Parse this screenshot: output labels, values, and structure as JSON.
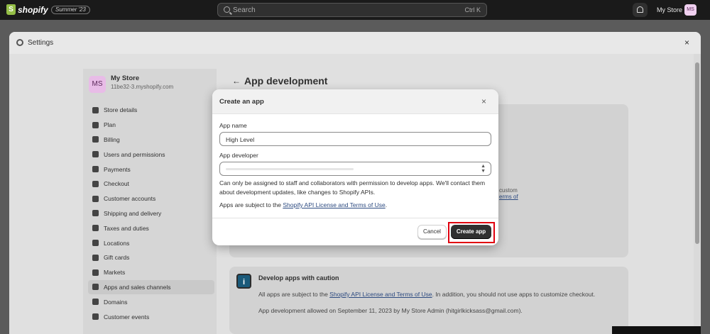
{
  "topbar": {
    "logo_text": "shopify",
    "edition": "Summer '23",
    "search_placeholder": "Search",
    "search_shortcut": "Ctrl K",
    "store_name": "My Store",
    "store_initials": "MS"
  },
  "settings": {
    "title": "Settings",
    "close_glyph": "×",
    "store": {
      "initials": "MS",
      "name": "My Store",
      "domain": "11be32-3.myshopify.com"
    },
    "nav_items": [
      {
        "label": "Store details",
        "icon": "store-icon"
      },
      {
        "label": "Plan",
        "icon": "plan-icon"
      },
      {
        "label": "Billing",
        "icon": "billing-icon"
      },
      {
        "label": "Users and permissions",
        "icon": "users-icon"
      },
      {
        "label": "Payments",
        "icon": "payments-icon"
      },
      {
        "label": "Checkout",
        "icon": "cart-icon"
      },
      {
        "label": "Customer accounts",
        "icon": "customer-icon"
      },
      {
        "label": "Shipping and delivery",
        "icon": "truck-icon"
      },
      {
        "label": "Taxes and duties",
        "icon": "taxes-icon"
      },
      {
        "label": "Locations",
        "icon": "location-icon"
      },
      {
        "label": "Gift cards",
        "icon": "gift-card-icon"
      },
      {
        "label": "Markets",
        "icon": "globe-icon"
      },
      {
        "label": "Apps and sales channels",
        "icon": "apps-icon"
      },
      {
        "label": "Domains",
        "icon": "domain-icon"
      },
      {
        "label": "Customer events",
        "icon": "events-icon"
      }
    ],
    "active_nav": "Apps and sales channels",
    "page_title": "App development",
    "back_glyph": "←",
    "card_fragments": {
      "line1": "custom",
      "line2": "erms of"
    },
    "caution_card": {
      "icon_glyph": "i",
      "title": "Develop apps with caution",
      "p1_prefix": "All apps are subject to the ",
      "p1_link": "Shopify API License and Terms of Use",
      "p1_suffix": ". In addition, you should not use apps to customize checkout.",
      "p2": "App development allowed on September 11, 2023 by My Store Admin (hitgirlkicksass@gmail.com)."
    }
  },
  "modal": {
    "title": "Create an app",
    "close_glyph": "×",
    "app_name_label": "App name",
    "app_name_value": "High Level",
    "developer_label": "App developer",
    "help_text": "Can only be assigned to staff and collaborators with permission to develop apps. We'll contact them about development updates, like changes to Shopify APIs.",
    "terms_prefix": "Apps are subject to the ",
    "terms_link": "Shopify API License and Terms of Use",
    "terms_suffix": ".",
    "cancel_label": "Cancel",
    "create_label": "Create app"
  },
  "colors": {
    "primary_button": "#303030",
    "highlight": "#e0000f",
    "link": "#2c4a80",
    "brand_green": "#95bf47"
  }
}
